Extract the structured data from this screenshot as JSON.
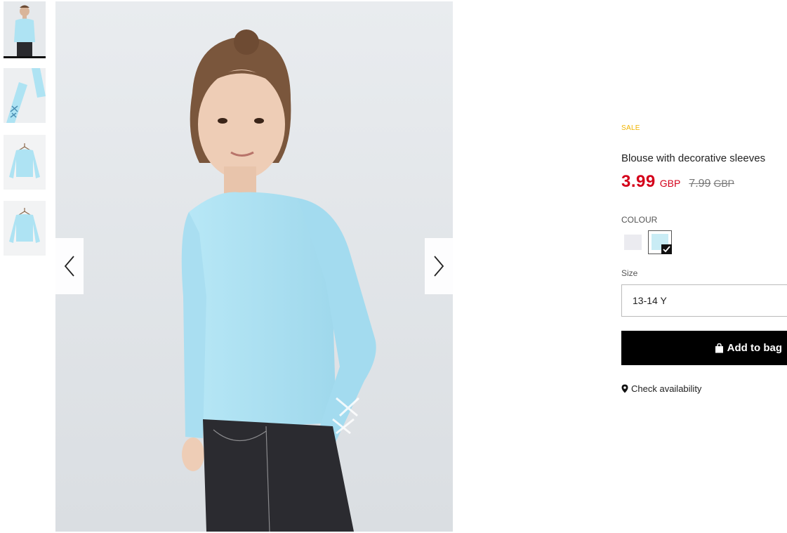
{
  "product": {
    "sale_label": "SALE",
    "title": "Blouse with decorative sleeves",
    "price_current": "3.99",
    "currency": "GBP",
    "price_old": "7.99",
    "price_old_currency": "GBP"
  },
  "colour": {
    "label": "COLOUR",
    "options": [
      {
        "name": "light-grey",
        "color": "#ebebf0",
        "selected": false
      },
      {
        "name": "light-blue",
        "color": "#c9ecf5",
        "selected": true
      }
    ]
  },
  "size": {
    "label": "Size",
    "selected": "13-14 Y"
  },
  "actions": {
    "add_to_bag": "Add to bag",
    "check_availability": "Check availability"
  },
  "gallery": {
    "thumbnails": [
      "model-front",
      "sleeve-detail",
      "hanger-front",
      "hanger-back"
    ],
    "active_index": 0
  },
  "colors": {
    "sale": "#f0b400",
    "price": "#d4001a",
    "primary_button": "#000000",
    "garment": "#aee3f3"
  }
}
